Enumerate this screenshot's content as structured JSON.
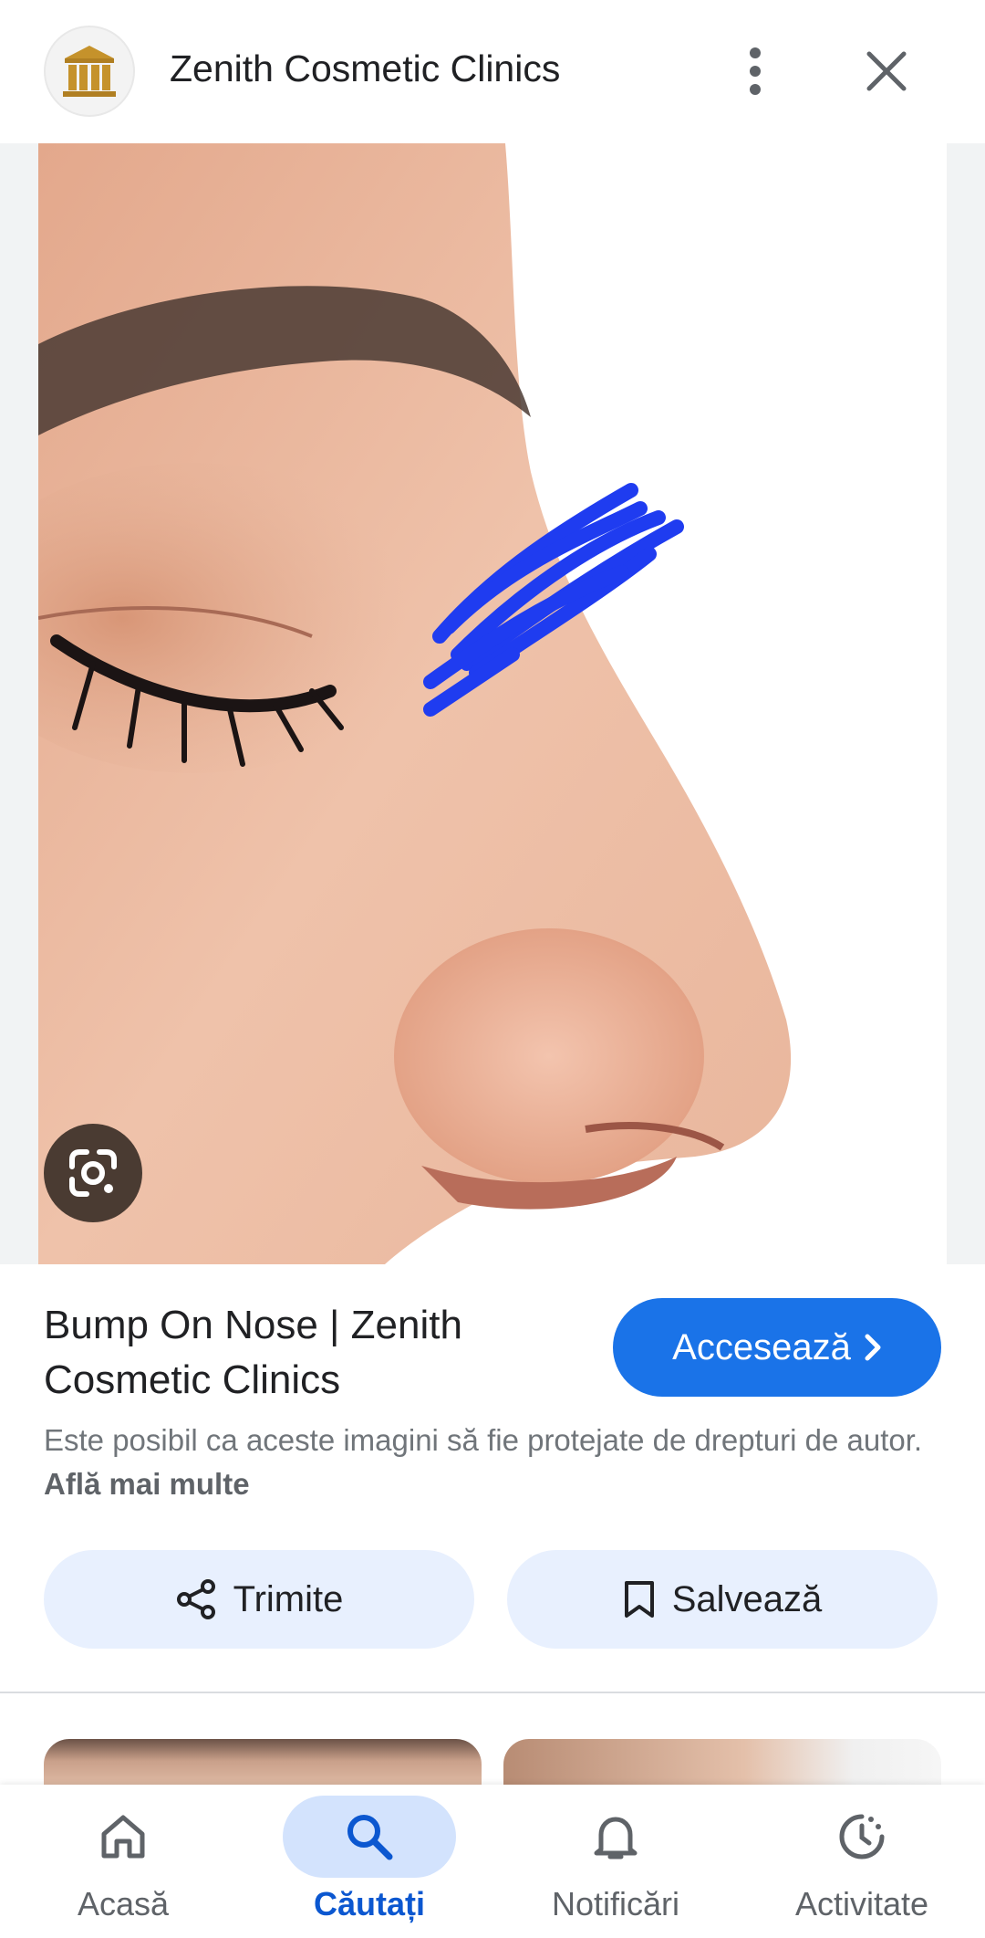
{
  "header": {
    "site_title": "Zenith Cosmetic Clinics",
    "logo_icon": "bank-building-icon",
    "more_icon": "more-vert-icon",
    "close_icon": "close-icon"
  },
  "image": {
    "lens_icon": "google-lens-icon"
  },
  "result": {
    "title": "Bump On Nose | Zenith Cosmetic Clinics",
    "visit_label": "Accesează",
    "copyright_text": "Este posibil ca aceste imagini să fie protejate de drepturi de autor.",
    "learn_more": "Află mai multe"
  },
  "actions": {
    "share_label": "Trimite",
    "save_label": "Salvează"
  },
  "nav": {
    "items": [
      {
        "label": "Acasă",
        "icon": "home-icon",
        "active": false
      },
      {
        "label": "Căutați",
        "icon": "search-icon",
        "active": true
      },
      {
        "label": "Notificări",
        "icon": "bell-icon",
        "active": false
      },
      {
        "label": "Activitate",
        "icon": "activity-icon",
        "active": false
      }
    ]
  },
  "colors": {
    "accent": "#1a73e8",
    "action_bg": "#e8f0fe",
    "logo_gold": "#c5922b"
  }
}
